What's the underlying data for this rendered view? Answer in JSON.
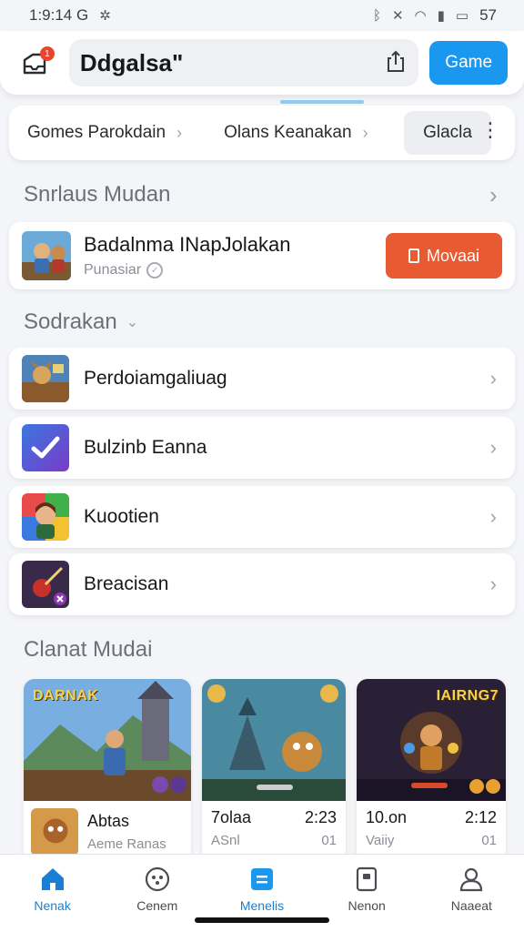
{
  "status_bar": {
    "time": "1:9:14 G",
    "battery": "57"
  },
  "header": {
    "notification_count": "1",
    "search_text": "Ddgalsa\"",
    "game_button": "Game"
  },
  "tabs": [
    {
      "label": "Gomes Parokdain"
    },
    {
      "label": "Olans Keanakan"
    },
    {
      "label": "Glacla"
    }
  ],
  "section_featured": {
    "title": "Snrlaus Mudan",
    "item": {
      "title": "Badalnma INapJolakan",
      "subtitle": "Punasiar",
      "button": "Movaai"
    }
  },
  "section_list": {
    "title": "Sodrakan",
    "items": [
      {
        "label": "Perdoiamgaliuag",
        "icon": "game-art-icon"
      },
      {
        "label": "Bulzinb Eanna",
        "icon": "checkmark-app-icon"
      },
      {
        "label": "Kuootien",
        "icon": "character-app-icon"
      },
      {
        "label": "Breacisan",
        "icon": "sword-app-icon"
      }
    ]
  },
  "section_games": {
    "title": "Clanat Mudai",
    "cards": [
      {
        "logo": "DARNAK",
        "title": "Abtas",
        "subtitle": "Aeme Ranas"
      },
      {
        "title": "7olaa",
        "time": "2:23",
        "subtitle": "ASnl",
        "count": "01"
      },
      {
        "logo": "IAIRNG7",
        "title": "10.on",
        "time": "2:12",
        "subtitle": "Vaiiy",
        "count": "01"
      }
    ]
  },
  "bottom_nav": [
    {
      "label": "Nenak",
      "icon": "home-icon",
      "active": true
    },
    {
      "label": "Cenem",
      "icon": "games-icon"
    },
    {
      "label": "Menelis",
      "icon": "menu-icon",
      "active": true
    },
    {
      "label": "Nenon",
      "icon": "card-icon"
    },
    {
      "label": "Naaeat",
      "icon": "profile-icon"
    }
  ],
  "colors": {
    "accent_blue": "#1a98f0",
    "action_orange": "#e85a32",
    "badge_red": "#e8452c"
  }
}
